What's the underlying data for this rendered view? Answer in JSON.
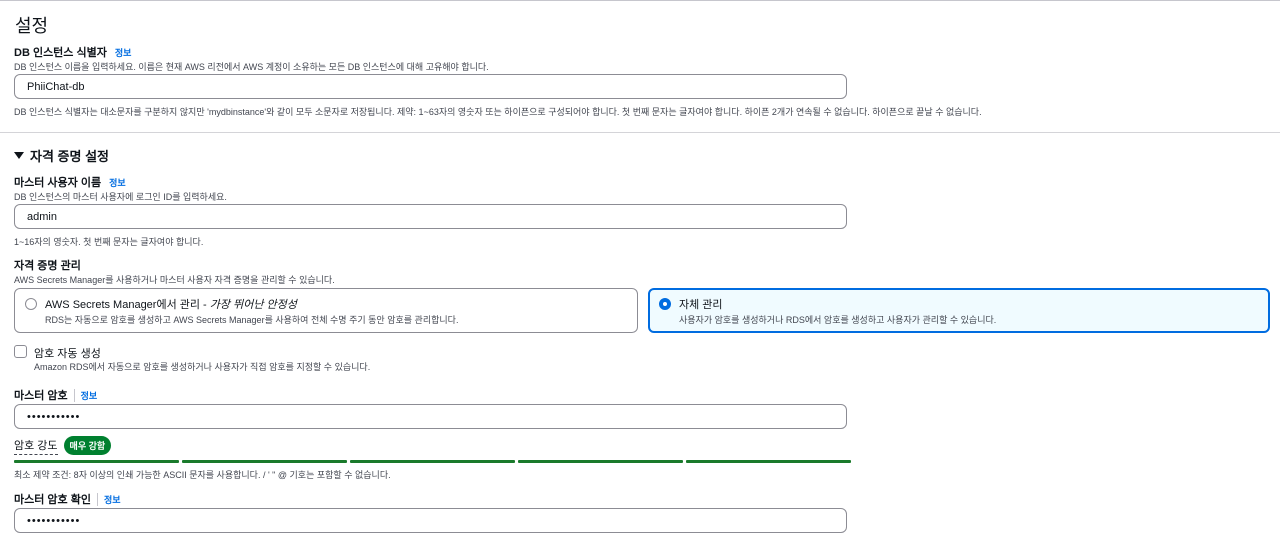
{
  "section": {
    "title": "설정"
  },
  "db_identifier": {
    "label": "DB 인스턴스 식별자",
    "info": "정보",
    "description": "DB 인스턴스 이름을 입력하세요. 이름은 현재 AWS 리전에서 AWS 계정이 소유하는 모든 DB 인스턴스에 대해 고유해야 합니다.",
    "value": "PhiiChat-db",
    "hint": "DB 인스턴스 식별자는 대소문자를 구분하지 않지만 'mydbinstance'와 같이 모두 소문자로 저장됩니다. 제약: 1~63자의 영숫자 또는 하이픈으로 구성되어야 합니다. 첫 번째 문자는 글자여야 합니다. 하이픈 2개가 연속될 수 없습니다. 하이픈으로 끝날 수 없습니다."
  },
  "credentials": {
    "title": "자격 증명 설정",
    "master_username": {
      "label": "마스터 사용자 이름",
      "info": "정보",
      "description": "DB 인스턴스의 마스터 사용자에 로그인 ID를 입력하세요.",
      "value": "admin",
      "hint": "1~16자의 영숫자. 첫 번째 문자는 글자여야 합니다."
    },
    "management": {
      "label": "자격 증명 관리",
      "description": "AWS Secrets Manager를 사용하거나 마스터 사용자 자격 증명을 관리할 수 있습니다.",
      "options": [
        {
          "title": "AWS Secrets Manager에서 관리 - ",
          "title_emphasis": "가장 뛰어난 안정성",
          "description": "RDS는 자동으로 암호를 생성하고 AWS Secrets Manager를 사용하여 전체 수명 주기 동안 암호를 관리합니다.",
          "selected": false
        },
        {
          "title": "자체 관리",
          "description": "사용자가 암호를 생성하거나 RDS에서 암호를 생성하고 사용자가 관리할 수 있습니다.",
          "selected": true
        }
      ]
    },
    "auto_generate": {
      "label": "암호 자동 생성",
      "description": "Amazon RDS에서 자동으로 암호를 생성하거나 사용자가 직접 암호를 지정할 수 있습니다.",
      "checked": false
    },
    "master_password": {
      "label": "마스터 암호",
      "info": "정보",
      "value": "•••••••••••"
    },
    "strength": {
      "label": "암호 강도",
      "badge": "매우 강함",
      "segments_filled": 5,
      "segments_total": 5,
      "color": "#1a7a2b",
      "constraint": "최소 제약 조건: 8자 이상의 인쇄 가능한 ASCII 문자를 사용합니다. / ' \" @ 기호는 포함할 수 없습니다."
    },
    "confirm_password": {
      "label": "마스터 암호 확인",
      "info": "정보",
      "value": "•••••••••••"
    }
  },
  "colors": {
    "accent": "#006ce0",
    "success": "#00802f",
    "selected_bg": "#f0fbff"
  }
}
